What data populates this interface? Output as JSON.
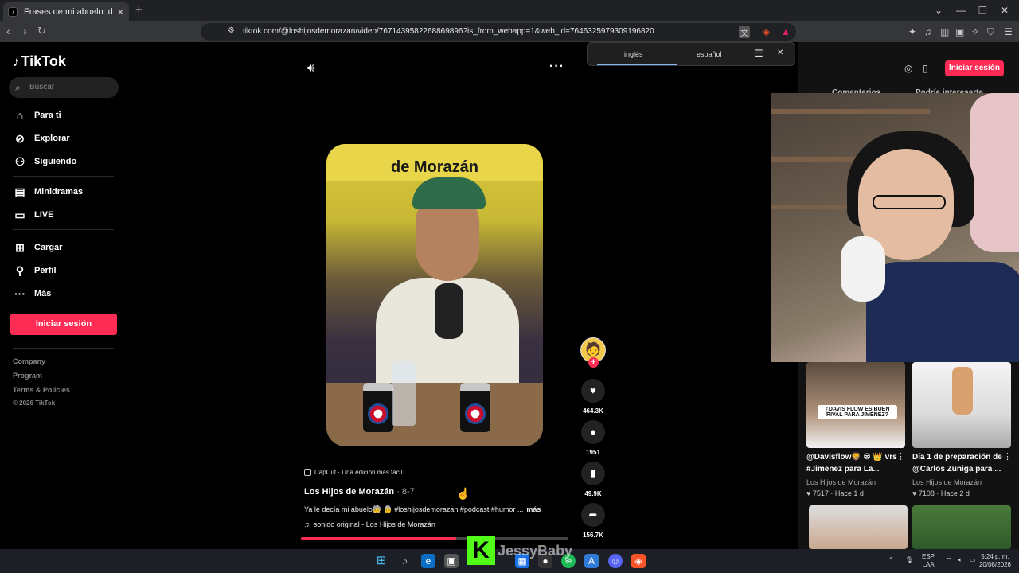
{
  "browser": {
    "tab_title": "Frases de mi abuelo: dichos, f",
    "tab_close": "✕",
    "new_tab": "+",
    "url": "tiktok.com/@loshijosdemorazan/video/7671439582268869896?is_from_webapp=1&web_id=7646325979309196820"
  },
  "sidebar": {
    "logo": "TikTok",
    "search_placeholder": "Buscar",
    "nav": [
      {
        "label": "Para ti",
        "icon": "home-icon"
      },
      {
        "label": "Explorar",
        "icon": "compass-icon"
      },
      {
        "label": "Siguiendo",
        "icon": "following-icon"
      },
      {
        "label": "Minidramas",
        "icon": "minidramas-icon"
      },
      {
        "label": "LIVE",
        "icon": "live-icon"
      },
      {
        "label": "Cargar",
        "icon": "upload-icon"
      },
      {
        "label": "Perfil",
        "icon": "profile-icon"
      },
      {
        "label": "Más",
        "icon": "more-icon"
      }
    ],
    "login": "Iniciar sesión",
    "footer": [
      "Company",
      "Program",
      "Terms & Policies",
      "© 2026 TikTok"
    ]
  },
  "translate": {
    "from": "inglés",
    "to": "español"
  },
  "video": {
    "banner_text": "de Morazán",
    "capcut": "CapCut · Una edición más fácil",
    "author": "Los Hijos de Morazán",
    "date": " · 8-7",
    "caption": "Ya le decía mi abuelo🧓 👵 #loshijosdemorazan #podcast #humor ...",
    "caption_more": "más",
    "sound": "sonido original - Los Hijos de Morazán",
    "progress": 0.58
  },
  "actions": {
    "likes": "464.3K",
    "comments": "1951",
    "saves": "49.9K",
    "shares": "156.7K"
  },
  "rightcol": {
    "login": "Iniciar sesión",
    "tabs": [
      "Comentarios",
      "Podría interesarte"
    ],
    "cards": [
      {
        "title": "@Davisflow🦁 ♾ 👑 vrs #Jimenez para La...",
        "author": "Los Hijos de Morazán",
        "views": "7517",
        "ago": "Hace 1 d",
        "thumb_text": "¿DAVIS FLOW ES BUEN RIVAL PARA JIMÉNEZ?"
      },
      {
        "title": "Día 1 de preparación de @Carlos Zuniga para ...",
        "author": "Los Hijos de Morazán",
        "views": "7108",
        "ago": "Hace 2 d"
      }
    ]
  },
  "overlay": {
    "kick_letter": "K",
    "name": "JessyBaby"
  },
  "taskbar": {
    "lang1": "ESP",
    "lang2": "LAA",
    "time": "5:24 p. m.",
    "date": "20/08/2026"
  }
}
